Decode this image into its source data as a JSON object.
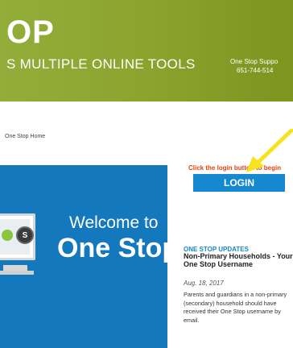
{
  "header": {
    "brand": "OP",
    "tagline": "S MULTIPLE ONLINE TOOLS",
    "support_line1": "One Stop Suppo",
    "support_line2": "651-744-514"
  },
  "breadcrumb": {
    "home": "One Stop Home"
  },
  "welcome": {
    "line1": "Welcome to",
    "line2": "One Stop",
    "badge": "S"
  },
  "login": {
    "hint": "Click the login button to begin",
    "button_label": "LOGIN"
  },
  "updates": {
    "heading": "ONE STOP UPDATES",
    "title": "Non-Primary Households - Your One Stop Username",
    "date": "Aug. 18, 2017",
    "body": "Parents and guardians in a non-primary (secondary) household should have received their One Stop username by email."
  },
  "colors": {
    "header_green": "#8da52f",
    "welcome_blue": "#1478bd",
    "login_blue": "#1688cf",
    "hint_orange": "#e8410e",
    "annotation_arrow": "#f5e31c"
  },
  "icons": {
    "monitor": "computer-monitor-icon",
    "arrow": "annotation-arrow-icon"
  }
}
